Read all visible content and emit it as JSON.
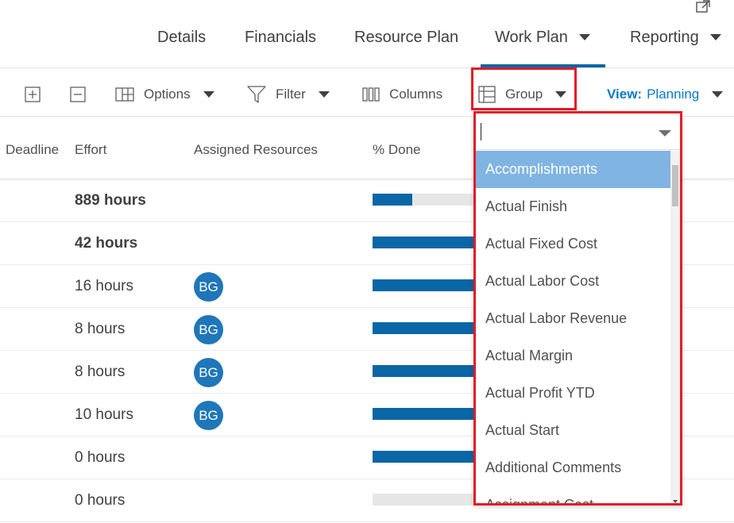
{
  "nav": {
    "tabs": [
      {
        "label": "Details"
      },
      {
        "label": "Financials"
      },
      {
        "label": "Resource Plan"
      },
      {
        "label": "Work Plan",
        "active": true
      },
      {
        "label": "Reporting"
      }
    ]
  },
  "toolbar": {
    "options_label": "Options",
    "filter_label": "Filter",
    "columns_label": "Columns",
    "group_label": "Group",
    "view_label": "View:",
    "view_value": "Planning"
  },
  "columns": [
    "Deadline",
    "Effort",
    "Assigned Resources",
    "% Done"
  ],
  "rows": [
    {
      "effort": "889 hours",
      "bold": true,
      "resource": "",
      "done_fraction": 0.31
    },
    {
      "effort": "42 hours",
      "bold": true,
      "resource": "",
      "done_fraction": 1.0
    },
    {
      "effort": "16 hours",
      "bold": false,
      "resource": "BG",
      "done_fraction": 1.0
    },
    {
      "effort": "8 hours",
      "bold": false,
      "resource": "BG",
      "done_fraction": 1.0
    },
    {
      "effort": "8 hours",
      "bold": false,
      "resource": "BG",
      "done_fraction": 1.0
    },
    {
      "effort": "10 hours",
      "bold": false,
      "resource": "BG",
      "done_fraction": 1.0
    },
    {
      "effort": "0 hours",
      "bold": false,
      "resource": "",
      "done_fraction": 1.0
    },
    {
      "effort": "0 hours",
      "bold": false,
      "resource": "",
      "done_fraction": 0.0
    }
  ],
  "group_dropdown": {
    "search_value": "",
    "items": [
      "Accomplishments",
      "Actual Finish",
      "Actual Fixed Cost",
      "Actual Labor Cost",
      "Actual Labor Revenue",
      "Actual Margin",
      "Actual Profit YTD",
      "Actual Start",
      "Additional Comments",
      "Assignment Cost"
    ],
    "highlighted_index": 0
  },
  "colors": {
    "accent": "#0a66a6",
    "link": "#0a78c8",
    "highlight_border": "#e01d27",
    "dropdown_active": "#7fb4e3",
    "avatar": "#1f76b9"
  }
}
